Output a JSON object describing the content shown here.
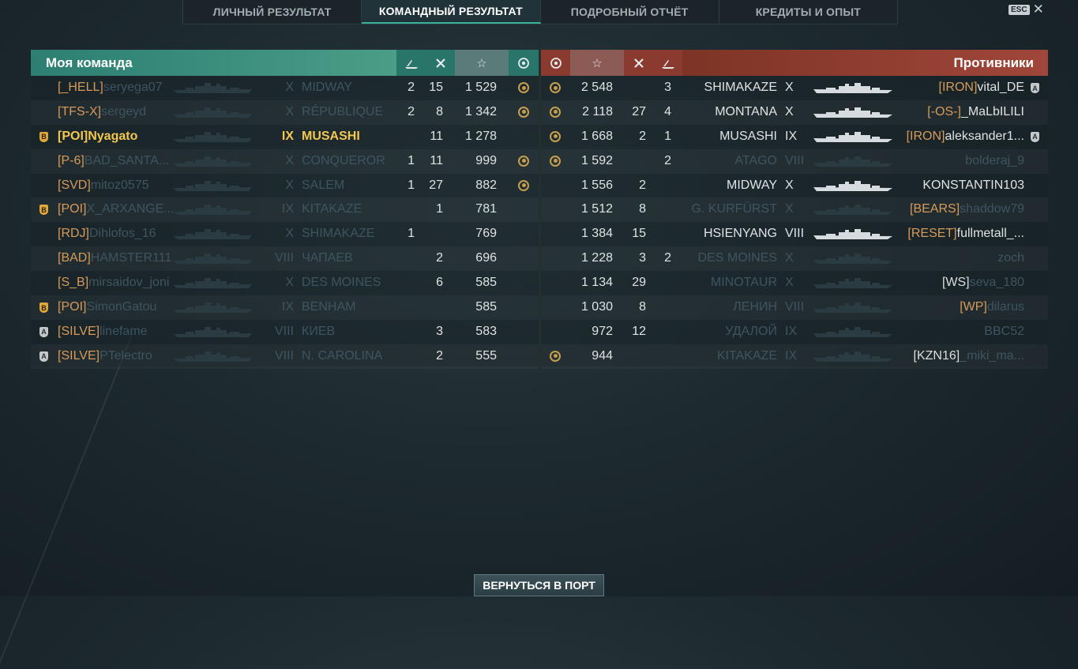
{
  "tabs": [
    "ЛИЧНЫЙ РЕЗУЛЬТАТ",
    "КОМАНДНЫЙ РЕЗУЛЬТАТ",
    "ПОДРОБНЫЙ ОТЧЁТ",
    "КРЕДИТЫ И ОПЫТ"
  ],
  "active_tab": 1,
  "esc_label": "ESC",
  "my_team": {
    "title": "Моя команда",
    "header_icons": [
      "ship-kills-icon",
      "plane-kills-icon",
      "star-icon",
      "medal-icon"
    ],
    "star_glyph": "☆",
    "rows": [
      {
        "badge": "",
        "clan": "[_HELL]",
        "name": "seryega07",
        "tier": "X",
        "ship": "MIDWAY",
        "ships": "2",
        "planes": "15",
        "score": "1 529",
        "medal": true,
        "dead": true
      },
      {
        "badge": "",
        "clan": "[TFS-X]",
        "name": "sergeyd",
        "tier": "X",
        "ship": "RÉPUBLIQUE",
        "ships": "2",
        "planes": "8",
        "score": "1 342",
        "medal": true,
        "dead": true
      },
      {
        "badge": "B",
        "clan": "[POI]",
        "name": "Nyagato",
        "tier": "IX",
        "ship": "MUSASHI",
        "ships": "",
        "planes": "11",
        "score": "1 278",
        "medal": false,
        "dead": false,
        "me": true
      },
      {
        "badge": "",
        "clan": "[P-6]",
        "name": "BAD_SANTA...",
        "tier": "X",
        "ship": "CONQUEROR",
        "ships": "1",
        "planes": "11",
        "score": "999",
        "medal": true,
        "dead": true
      },
      {
        "badge": "",
        "clan": "[SVD]",
        "name": "mitoz0575",
        "tier": "X",
        "ship": "SALEM",
        "ships": "1",
        "planes": "27",
        "score": "882",
        "medal": true,
        "dead": true
      },
      {
        "badge": "B",
        "clan": "[POI]",
        "name": "X_ARXANGE...",
        "tier": "IX",
        "ship": "KITAKAZE",
        "ships": "",
        "planes": "1",
        "score": "781",
        "medal": false,
        "dead": true
      },
      {
        "badge": "",
        "clan": "[RDJ]",
        "name": "Dihlofos_16",
        "tier": "X",
        "ship": "SHIMAKAZE",
        "ships": "1",
        "planes": "",
        "score": "769",
        "medal": false,
        "dead": true
      },
      {
        "badge": "",
        "clan": "[BAD]",
        "name": "HAMSTER111",
        "tier": "VIII",
        "ship": "ЧАПАЕВ",
        "ships": "",
        "planes": "2",
        "score": "696",
        "medal": false,
        "dead": true
      },
      {
        "badge": "",
        "clan": "[S_B]",
        "name": "mirsaidov_joni",
        "tier": "X",
        "ship": "DES MOINES",
        "ships": "",
        "planes": "6",
        "score": "585",
        "medal": false,
        "dead": true
      },
      {
        "badge": "B",
        "clan": "[POI]",
        "name": "SimonGatou",
        "tier": "IX",
        "ship": "BENHAM",
        "ships": "",
        "planes": "",
        "score": "585",
        "medal": false,
        "dead": true
      },
      {
        "badge": "A",
        "clan": "[SILVE]",
        "name": "linefame",
        "tier": "VIII",
        "ship": "КИЕВ",
        "ships": "",
        "planes": "3",
        "score": "583",
        "medal": false,
        "dead": true
      },
      {
        "badge": "A",
        "clan": "[SILVE]",
        "name": "PTelectro",
        "tier": "VIII",
        "ship": "N. CAROLINA",
        "ships": "",
        "planes": "2",
        "score": "555",
        "medal": false,
        "dead": true
      }
    ]
  },
  "enemy_team": {
    "title": "Противники",
    "star_glyph": "☆",
    "rows": [
      {
        "medal": true,
        "score": "2 548",
        "planes": "",
        "ships": "3",
        "ship": "SHIMAKAZE",
        "tier": "X",
        "clan": "[IRON]",
        "name": "vital_DE",
        "badge": "A",
        "dead": false
      },
      {
        "medal": true,
        "score": "2 118",
        "planes": "27",
        "ships": "4",
        "ship": "MONTANA",
        "tier": "X",
        "clan": "[-OS-]",
        "name": "_MaLbILILI",
        "badge": "",
        "dead": false
      },
      {
        "medal": true,
        "score": "1 668",
        "planes": "2",
        "ships": "1",
        "ship": "MUSASHI",
        "tier": "IX",
        "clan": "[IRON]",
        "name": "aleksander1...",
        "badge": "A",
        "dead": false
      },
      {
        "medal": true,
        "score": "1 592",
        "planes": "",
        "ships": "2",
        "ship": "ATAGO",
        "tier": "VIII",
        "clan": "",
        "name": "bolderaj_9",
        "badge": "",
        "dead": true
      },
      {
        "medal": false,
        "score": "1 556",
        "planes": "2",
        "ships": "",
        "ship": "MIDWAY",
        "tier": "X",
        "clan": "",
        "name": "KONSTANTIN103",
        "badge": "",
        "dead": false
      },
      {
        "medal": false,
        "score": "1 512",
        "planes": "8",
        "ships": "",
        "ship": "G. KURFÜRST",
        "tier": "X",
        "clan": "[BEARS]",
        "name": "shaddow79",
        "badge": "",
        "dead": true
      },
      {
        "medal": false,
        "score": "1 384",
        "planes": "15",
        "ships": "",
        "ship": "HSIENYANG",
        "tier": "VIII",
        "clan": "[RESET]",
        "name": "fullmetall_...",
        "badge": "",
        "dead": false
      },
      {
        "medal": false,
        "score": "1 228",
        "planes": "3",
        "ships": "2",
        "ship": "DES MOINES",
        "tier": "X",
        "clan": "",
        "name": "zoch",
        "badge": "",
        "dead": true
      },
      {
        "medal": false,
        "score": "1 134",
        "planes": "29",
        "ships": "",
        "ship": "MINOTAUR",
        "tier": "X",
        "clan": "[WS]",
        "name": "seva_180",
        "badge": "",
        "dead": true,
        "clan_white": true
      },
      {
        "medal": false,
        "score": "1 030",
        "planes": "8",
        "ships": "",
        "ship": "ЛЕНИН",
        "tier": "VIII",
        "clan": "[WP]",
        "name": "dilarus",
        "badge": "",
        "dead": true
      },
      {
        "medal": false,
        "score": "972",
        "planes": "12",
        "ships": "",
        "ship": "УДАЛОЙ",
        "tier": "IX",
        "clan": "",
        "name": "BBC52",
        "badge": "",
        "dead": true
      },
      {
        "medal": true,
        "score": "944",
        "planes": "",
        "ships": "",
        "ship": "KITAKAZE",
        "tier": "IX",
        "clan": "[KZN16]",
        "name": "_miki_ma...",
        "badge": "",
        "dead": true,
        "clan_white": true
      }
    ]
  },
  "return_button": "ВЕРНУТЬСЯ В ПОРТ",
  "colors": {
    "my_team": "#2c7f72",
    "enemy": "#a0463a",
    "clan": "#d69a5a",
    "me": "#f2c74f",
    "dead": "#3e5560"
  }
}
